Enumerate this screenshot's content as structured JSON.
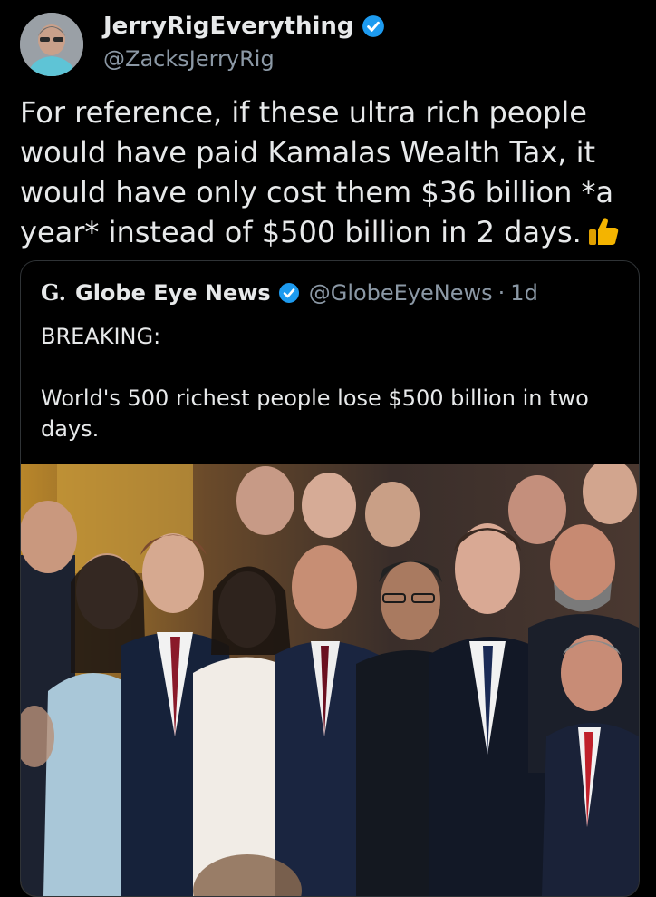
{
  "tweet": {
    "author_name": "JerryRigEverything",
    "author_handle": "@ZacksJerryRig",
    "text": "For reference, if these ultra rich people would have paid Kamalas Wealth Tax, it would have only cost them $36 billion *a year* instead of $500 billion in 2 days.",
    "emoji_icon": "thumbs-up-icon",
    "verified_color": "#1d9bf0"
  },
  "quote": {
    "logo_text": "G.",
    "author_name": "Globe Eye News",
    "author_handle": "@GlobeEyeNews",
    "separator": "·",
    "time": "1d",
    "text_line1": "BREAKING:",
    "text_line2": "World's 500 richest people lose $500 billion in two days."
  },
  "colors": {
    "background": "#000000",
    "text": "#e7e9ea",
    "muted": "#8b98a5",
    "border": "#2f3336",
    "verified": "#1d9bf0",
    "thumbs": "#f4b400"
  }
}
